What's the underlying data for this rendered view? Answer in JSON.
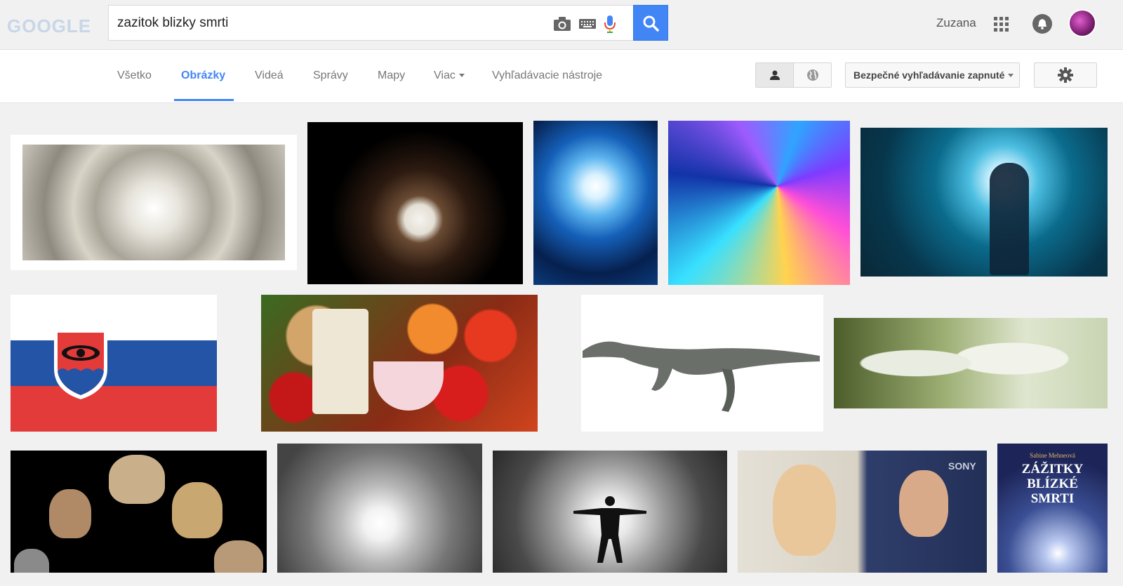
{
  "header": {
    "logo_text": "GOOGLE",
    "search_query": "zazitok blizky smrti",
    "user_name": "Zuzana"
  },
  "tabs": [
    {
      "label": "Všetko",
      "active": false
    },
    {
      "label": "Obrázky",
      "active": true
    },
    {
      "label": "Videá",
      "active": false
    },
    {
      "label": "Správy",
      "active": false
    },
    {
      "label": "Mapy",
      "active": false
    },
    {
      "label": "Viac",
      "active": false,
      "dropdown": true
    },
    {
      "label": "Vyhľadávacie nástroje",
      "active": false
    }
  ],
  "toolbar": {
    "safesearch_label": "Bezpečné vyhľadávanie zapnuté"
  },
  "book_cover": {
    "author": "Sabine Mehneová",
    "title_line1": "ZÁŽITKY",
    "title_line2": "BLÍZKÉ",
    "title_line3": "SMRTI"
  },
  "thumb_labels": {
    "sony": "SONY"
  },
  "colors": {
    "accent": "#4285f4",
    "topbar_bg": "#f1f1f1",
    "tab_active": "#4285f4"
  },
  "icons": [
    "camera-icon",
    "keyboard-icon",
    "microphone-icon",
    "search-icon",
    "apps-grid-icon",
    "notification-bell-icon",
    "person-icon",
    "globe-icon",
    "gear-icon"
  ]
}
